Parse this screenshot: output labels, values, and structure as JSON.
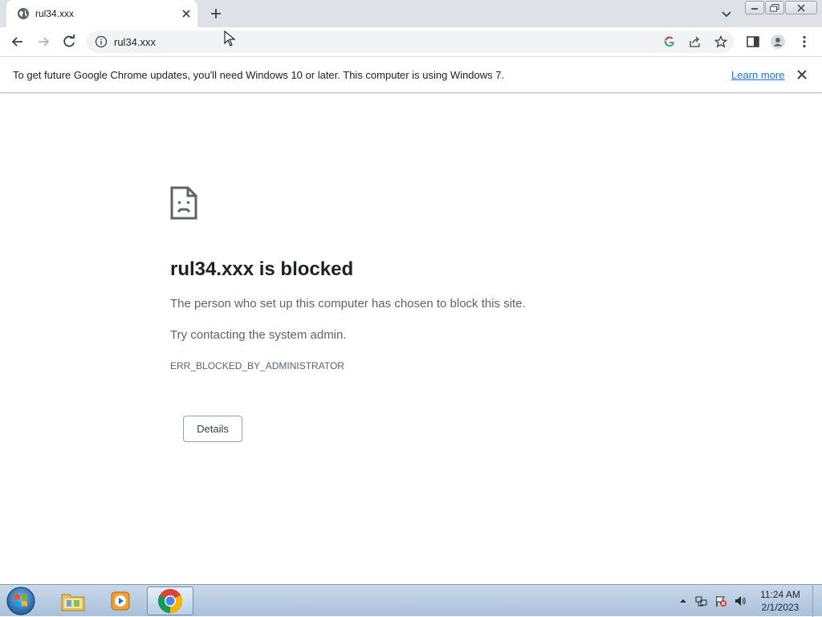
{
  "tab": {
    "title": "rul34.xxx"
  },
  "address": {
    "url": "rul34.xxx"
  },
  "infobar": {
    "message": "To get future Google Chrome updates, you'll need Windows 10 or later. This computer is using Windows 7.",
    "link_label": "Learn more"
  },
  "error": {
    "title": "rul34.xxx is blocked",
    "description": "The person who set up this computer has chosen to block this site.",
    "hint": "Try contacting the system admin.",
    "code": "ERR_BLOCKED_BY_ADMINISTRATOR",
    "details_label": "Details"
  },
  "taskbar": {
    "time": "11:24 AM",
    "date": "2/1/2023"
  },
  "colors": {
    "tabstrip": "#dee1e6",
    "link": "#1a73e8",
    "title_text": "#202124",
    "secondary_text": "#5f6368"
  }
}
